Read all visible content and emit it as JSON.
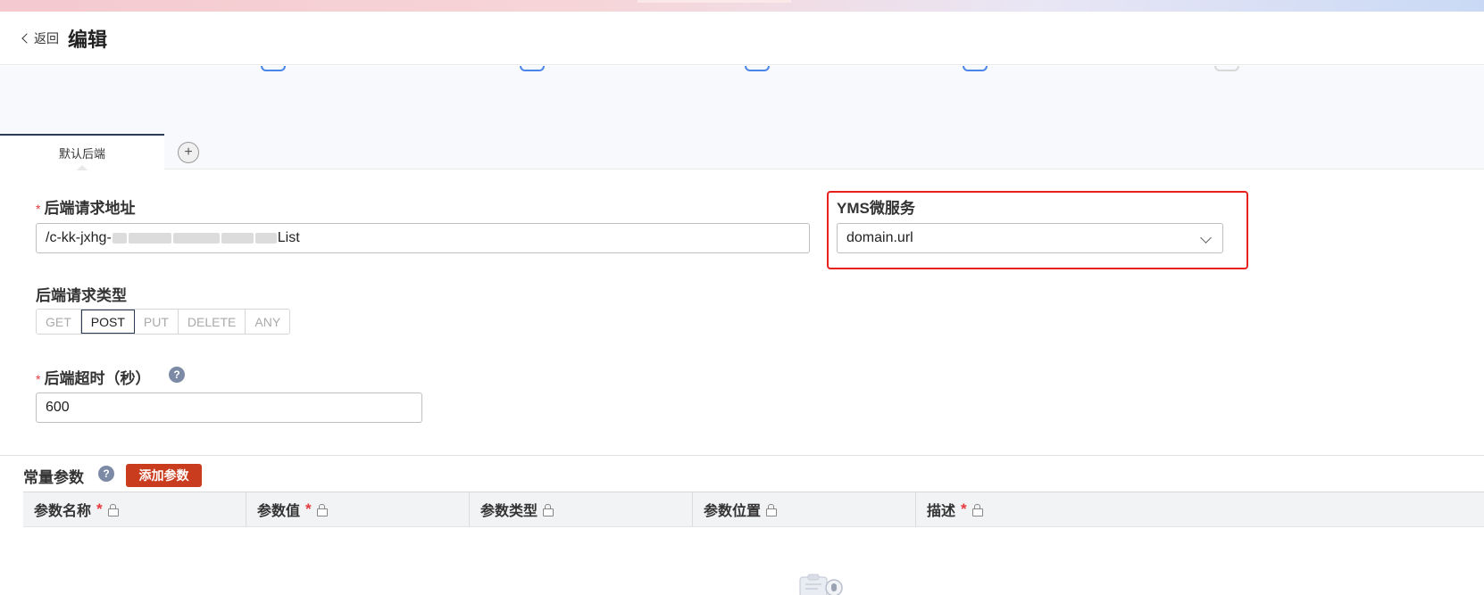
{
  "header": {
    "back_label": "返回",
    "title": "编辑"
  },
  "tabs": {
    "items": [
      {
        "label": "默认后端"
      }
    ],
    "add_label": "+"
  },
  "form": {
    "backend_url": {
      "label": "后端请求地址",
      "required_mark": "*",
      "value_prefix": "/c-kk-jxhg-",
      "value_suffix": "List"
    },
    "yms_service": {
      "label": "YMS微服务",
      "value": "domain.url"
    },
    "request_type": {
      "label": "后端请求类型",
      "options": [
        "GET",
        "POST",
        "PUT",
        "DELETE",
        "ANY"
      ],
      "selected": "POST"
    },
    "timeout": {
      "label": "后端超时（秒）",
      "required_mark": "*",
      "help": "?",
      "value": "600"
    }
  },
  "constants": {
    "title": "常量参数",
    "help": "?",
    "add_button": "添加参数",
    "columns": [
      {
        "label": "参数名称",
        "required": "*"
      },
      {
        "label": "参数值",
        "required": "*"
      },
      {
        "label": "参数类型",
        "required": ""
      },
      {
        "label": "参数位置",
        "required": ""
      },
      {
        "label": "描述",
        "required": "*"
      }
    ]
  },
  "colors": {
    "accent": "#2b3a55",
    "danger": "#e4393c",
    "add_button": "#c93c1e",
    "highlight": "#e8211d"
  }
}
